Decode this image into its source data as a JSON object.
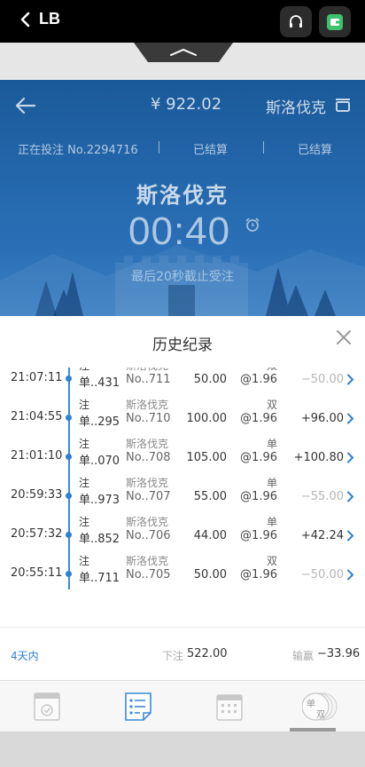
{
  "topbar": {
    "back_label": "LB"
  },
  "header": {
    "balance": "¥ 922.02",
    "game_name": "斯洛伐克",
    "status": {
      "current": "正在投注 No.2294716",
      "settled_1": "已结算",
      "settled_2": "已结算"
    },
    "title": "斯洛伐克",
    "timer": "00:40",
    "cutoff_notice": "最后20秒截止受注"
  },
  "history": {
    "title": "历史纪录",
    "rows": [
      {
        "time": "21:07:11",
        "bet_label": "注",
        "bet_id": "单..431",
        "game": "斯洛伐克",
        "issue": "No..711",
        "amount": "50.00",
        "selection": "双",
        "odds": "@1.96",
        "result": "−50.00",
        "negative": true
      },
      {
        "time": "21:04:55",
        "bet_label": "注",
        "bet_id": "单..295",
        "game": "斯洛伐克",
        "issue": "No..710",
        "amount": "100.00",
        "selection": "双",
        "odds": "@1.96",
        "result": "+96.00",
        "negative": false
      },
      {
        "time": "21:01:10",
        "bet_label": "注",
        "bet_id": "单..070",
        "game": "斯洛伐克",
        "issue": "No..708",
        "amount": "105.00",
        "selection": "单",
        "odds": "@1.96",
        "result": "+100.80",
        "negative": false
      },
      {
        "time": "20:59:33",
        "bet_label": "注",
        "bet_id": "单..973",
        "game": "斯洛伐克",
        "issue": "No..707",
        "amount": "55.00",
        "selection": "单",
        "odds": "@1.96",
        "result": "−55.00",
        "negative": true
      },
      {
        "time": "20:57:32",
        "bet_label": "注",
        "bet_id": "单..852",
        "game": "斯洛伐克",
        "issue": "No..706",
        "amount": "44.00",
        "selection": "单",
        "odds": "@1.96",
        "result": "+42.24",
        "negative": false
      },
      {
        "time": "20:55:11",
        "bet_label": "注",
        "bet_id": "单..711",
        "game": "斯洛伐克",
        "issue": "No..705",
        "amount": "50.00",
        "selection": "双",
        "odds": "@1.96",
        "result": "−50.00",
        "negative": true
      }
    ]
  },
  "summary": {
    "period": "4天内",
    "stake_label": "下注",
    "stake_value": "522.00",
    "pl_label": "输赢",
    "pl_value": "−33.96"
  },
  "bottomnav": {
    "items": [
      {
        "icon": "document-check-icon"
      },
      {
        "icon": "list-note-icon",
        "active": true
      },
      {
        "icon": "calendar-icon"
      },
      {
        "icon": "odd-even-badge-icon",
        "line1": "单",
        "line2": "双"
      }
    ]
  },
  "colors": {
    "accent": "#2f80d0",
    "header_blue": "#2a6fb6",
    "wallet_green": "#3ec16e"
  }
}
